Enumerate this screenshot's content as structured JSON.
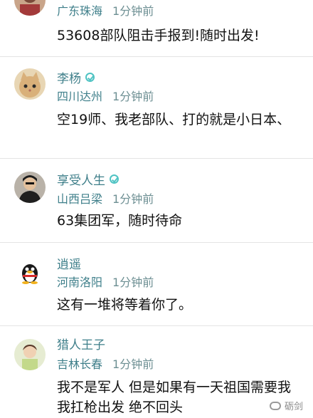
{
  "comments": [
    {
      "user": "",
      "location": "广东珠海",
      "time": "1分钟前",
      "text": "53608部队阻击手报到!随时出发!",
      "avatar": "person-avatar"
    },
    {
      "user": "李杨",
      "location": "四川达州",
      "time": "1分钟前",
      "text": "空19师、我老部队、打的就是小日本、",
      "avatar": "cat-avatar"
    },
    {
      "user": "享受人生",
      "location": "山西吕梁",
      "time": "1分钟前",
      "text": "63集团军，随时待命",
      "avatar": "man-avatar"
    },
    {
      "user": "逍遥",
      "location": "河南洛阳",
      "time": "1分钟前",
      "text": "这有一堆将等着你了。",
      "avatar": "qq-penguin-avatar"
    },
    {
      "user": "猎人王子",
      "location": "吉林长春",
      "time": "1分钟前",
      "text": "我不是军人 但是如果有一天祖国需要我 我扛枪出发 绝不回头",
      "avatar": "child-avatar"
    }
  ],
  "watermark": "砺剑"
}
